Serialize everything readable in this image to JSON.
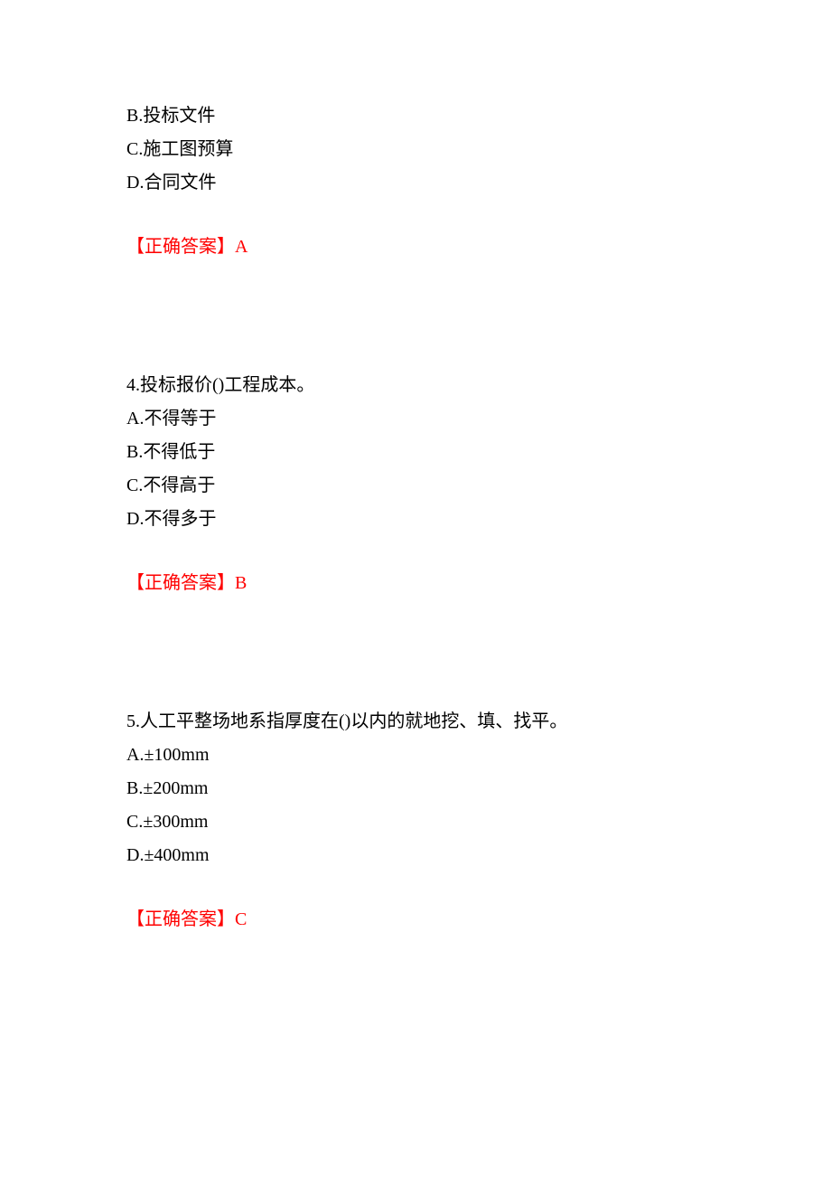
{
  "q3_partial": {
    "options": {
      "b": "B.投标文件",
      "c": "C.施工图预算",
      "d": "D.合同文件"
    },
    "answer_label": "【正确答案】",
    "answer_value": "A"
  },
  "q4": {
    "question": "4.投标报价()工程成本。",
    "options": {
      "a": "A.不得等于",
      "b": "B.不得低于",
      "c": "C.不得高于",
      "d": "D.不得多于"
    },
    "answer_label": "【正确答案】",
    "answer_value": "B"
  },
  "q5": {
    "question": "5.人工平整场地系指厚度在()以内的就地挖、填、找平。",
    "options": {
      "a": "A.±100mm",
      "b": "B.±200mm",
      "c": "C.±300mm",
      "d": "D.±400mm"
    },
    "answer_label": "【正确答案】",
    "answer_value": "C"
  }
}
